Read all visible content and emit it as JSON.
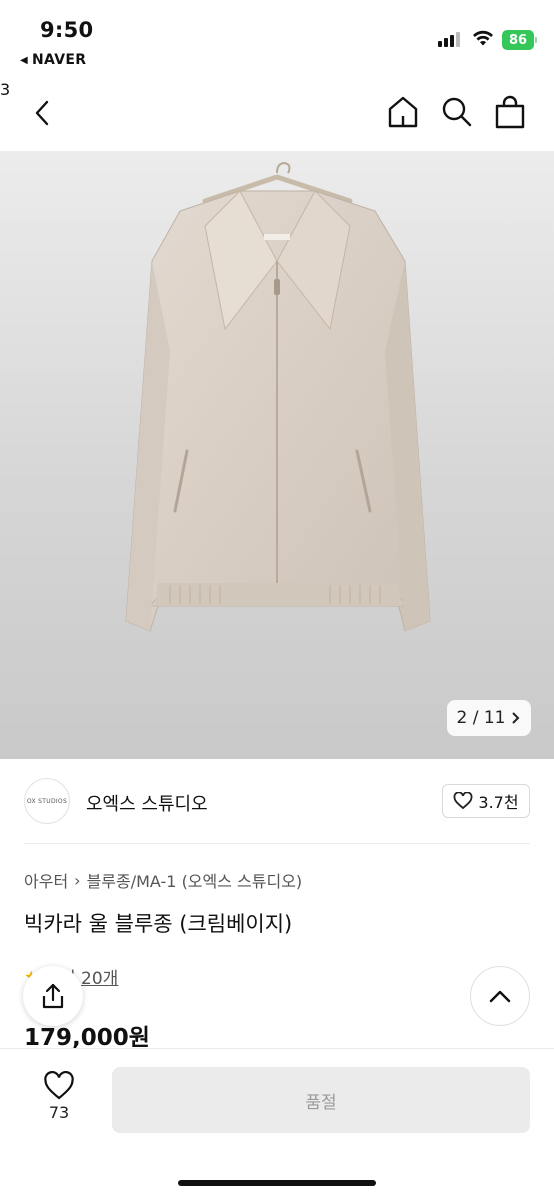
{
  "status_bar": {
    "time": "9:50",
    "back_app": "NAVER",
    "battery": "86"
  },
  "nav": {
    "cart_count": "3"
  },
  "gallery": {
    "counter": "2 / 11",
    "product_brand_on_label": "OX STUDIOS"
  },
  "brand": {
    "logo_text": "OX STUDIOS",
    "name": "오엑스 스튜디오",
    "likes": "3.7천"
  },
  "breadcrumb": {
    "items": [
      "아우터",
      "블루종/MA-1 (오엑스 스튜디오)"
    ]
  },
  "product": {
    "title": "빅카라 울 블루종 (크림베이지)",
    "review_text": "후기 20개",
    "price": "179,000원"
  },
  "bottom_bar": {
    "like_count": "73",
    "buy_label": "품절"
  },
  "colors": {
    "accent": "#3d8ef0",
    "battery": "#35c759",
    "star": "#f4b400",
    "jacket": "#d8cec4"
  },
  "icons": [
    "chevron-left-icon",
    "home-icon",
    "search-icon",
    "shopping-bag-icon",
    "heart-icon",
    "share-icon",
    "chevron-up-icon",
    "chevron-right-icon",
    "star-icon"
  ]
}
